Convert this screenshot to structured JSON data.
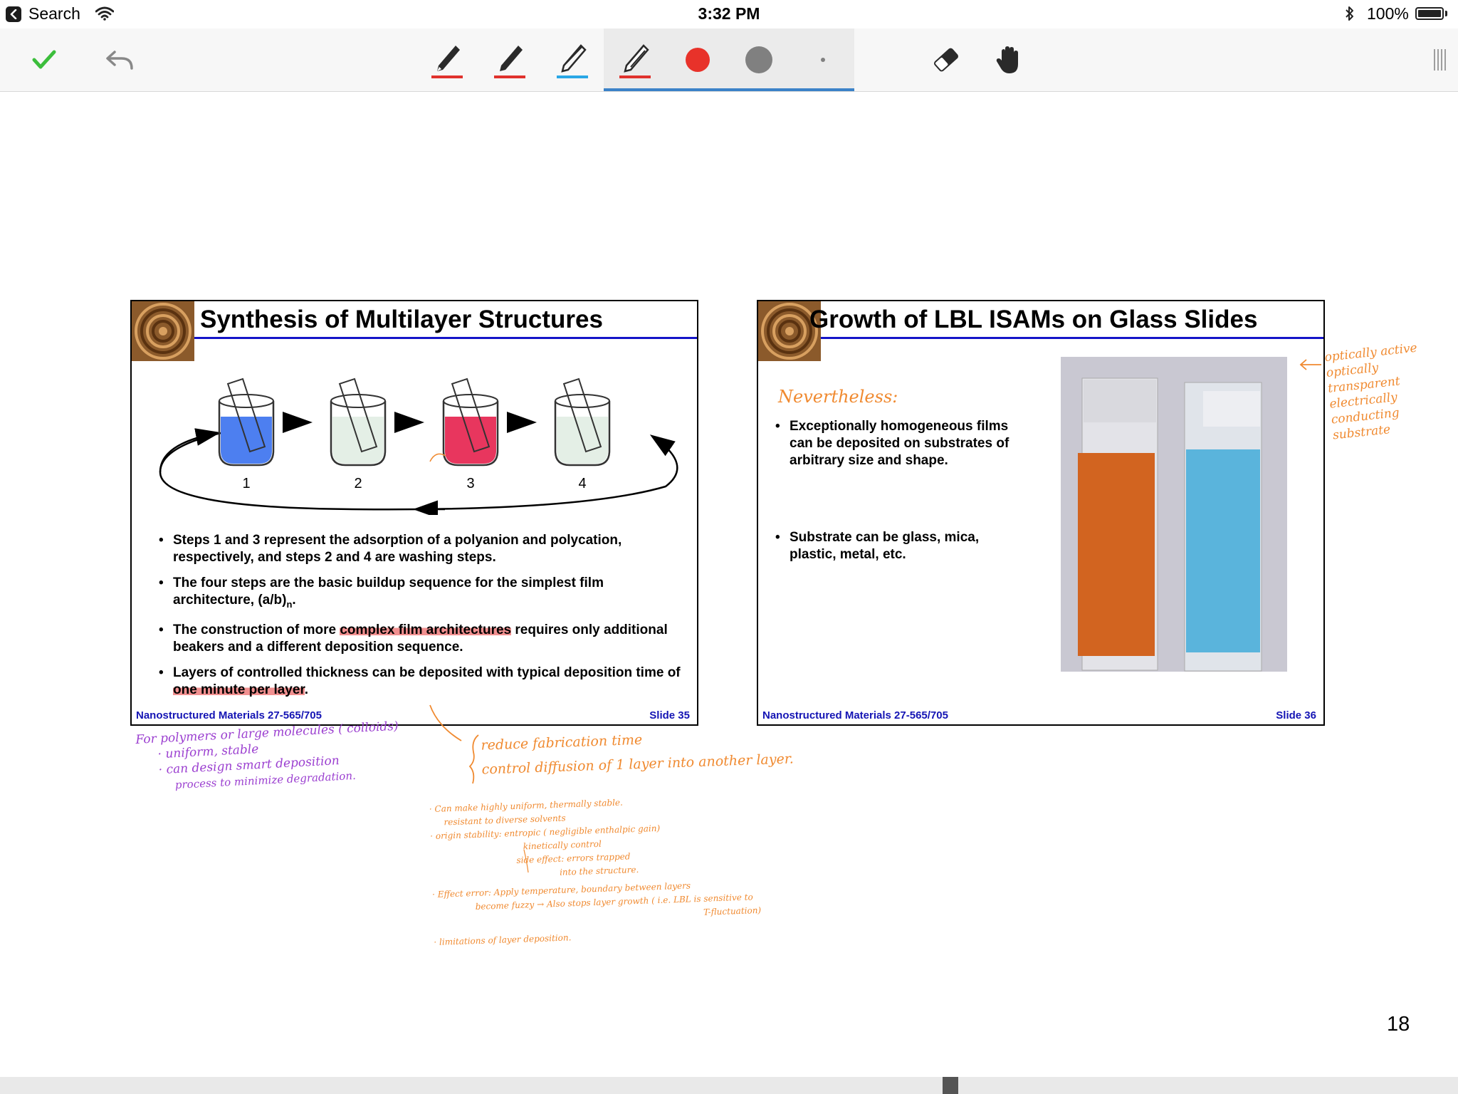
{
  "status_bar": {
    "back_label": "Search",
    "time": "3:32 PM",
    "battery": "100%"
  },
  "toolbar": {
    "tools": [
      {
        "name": "pen-red",
        "accent": "#e0322d"
      },
      {
        "name": "pen-red-2",
        "accent": "#e0322d"
      },
      {
        "name": "pencil-blue",
        "accent": "#2aa7e6"
      },
      {
        "name": "highlighter-red",
        "accent": "#e0322d",
        "active": true
      }
    ],
    "color_swatch": "#e8322a",
    "gray_swatch": "#808080",
    "icons": [
      "checkmark-icon",
      "undo-icon",
      "eraser-icon",
      "hand-icon",
      "menu-icon"
    ]
  },
  "slides": [
    {
      "title": "Synthesis of Multilayer Structures",
      "beaker_labels": [
        "1",
        "2",
        "3",
        "4"
      ],
      "beaker_colors": [
        "#4d7ff0",
        "#e4efe6",
        "#e8365e",
        "#e4efe6"
      ],
      "bullets": [
        {
          "text": "Steps 1 and 3 represent the adsorption of a polyanion and polycation, respectively, and steps 2 and 4 are washing steps."
        },
        {
          "text": "The four steps are the basic buildup sequence for the simplest film architecture, (a/b)",
          "sub": "n",
          "tail": "."
        },
        {
          "pre": "The construction of more ",
          "hl": "complex film architectures",
          "post": " requires only additional beakers and a different deposition sequence."
        },
        {
          "pre": "Layers of controlled thickness can be deposited with typical deposition time of ",
          "hl": "one minute per layer",
          "post": "."
        }
      ],
      "footer_left": "Nanostructured Materials 27-565/705",
      "footer_right": "Slide 35"
    },
    {
      "title": "Growth of LBL ISAMs on Glass Slides",
      "bullets": [
        {
          "text": "Exceptionally homogeneous films can be deposited on substrates of arbitrary size and shape."
        },
        {
          "text": "Substrate can be glass, mica, plastic, metal, etc."
        }
      ],
      "footer_left": "Nanostructured Materials 27-565/705",
      "footer_right": "Slide 36"
    }
  ],
  "handwritten_notes": {
    "slide36_heading": "Nevertheless:",
    "slide36_side": [
      "optically active",
      "optically transparent",
      "electrically conducting substrate"
    ],
    "purple": [
      "For polymers or large molecules ( colloids)",
      "· uniform, stable",
      "· can design smart deposition",
      "process to minimize degradation."
    ],
    "orange_top": [
      "reduce fabrication time",
      "control diffusion of 1 layer into another layer."
    ],
    "orange_list": [
      "· Can make highly uniform, thermally stable.",
      "resistant to diverse solvents",
      "· origin stability: entropic ( negligible enthalpic gain)",
      "kinetically control",
      "side effect: errors trapped",
      "into the structure.",
      "· Effect error: Apply temperature, boundary between layers",
      "become fuzzy → Also stops layer growth ( i.e. LBL is sensitive to",
      "T-fluctuation)",
      "· limitations of layer deposition."
    ]
  },
  "page_number": "18"
}
